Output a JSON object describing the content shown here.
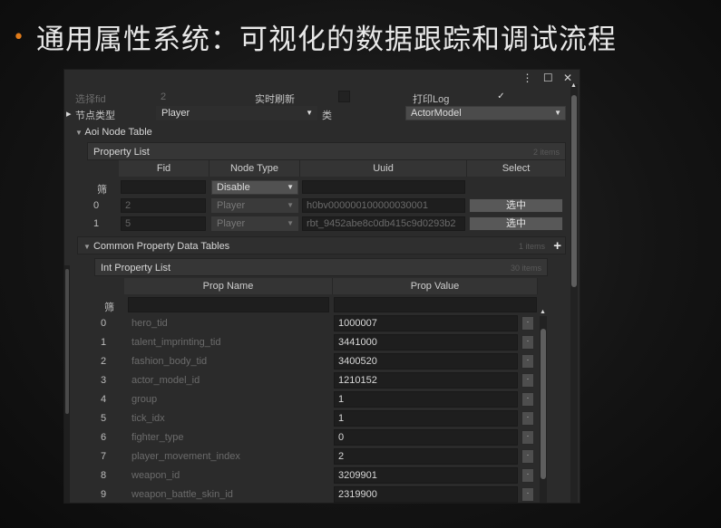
{
  "slide": {
    "bullet": "•",
    "title": "通用属性系统：可视化的数据跟踪和调试流程"
  },
  "window": {
    "controls": "⋮ ☐ ✕"
  },
  "filter_row": {
    "select_fid_label": "选择fid",
    "select_fid_value": "2",
    "refresh_label": "实时刷新",
    "refresh_checked": false,
    "log_label": "打印Log",
    "log_checked": true,
    "log_check_mark": "✓"
  },
  "node_type_row": {
    "label": "节点类型",
    "value": "Player",
    "class_label": "类",
    "class_value": "ActorModel"
  },
  "aoi_table": {
    "title": "Aoi Node Table",
    "list_title": "Property List",
    "count": "2 items",
    "columns": [
      "Fid",
      "Node Type",
      "Uuid",
      "Select"
    ],
    "filter_label": "筛",
    "filter_dropdown": "Disable",
    "rows": [
      {
        "index": "0",
        "fid": "2",
        "node_type": "Player",
        "uuid": "h0bv000000100000030001",
        "select": "选中"
      },
      {
        "index": "1",
        "fid": "5",
        "node_type": "Player",
        "uuid": "rbt_9452abe8c0db415c9d0293b2",
        "select": "选中"
      }
    ]
  },
  "common_tables": {
    "title": "Common Property Data Tables",
    "count": "1 items",
    "add_icon": "+",
    "int_list": {
      "title": "Int Property List",
      "count": "30 items",
      "columns": [
        "Prop Name",
        "Prop Value"
      ],
      "filter_label": "筛",
      "rows": [
        {
          "index": "0",
          "name": "hero_tid",
          "value": "1000007"
        },
        {
          "index": "1",
          "name": "talent_imprinting_tid",
          "value": "3441000"
        },
        {
          "index": "2",
          "name": "fashion_body_tid",
          "value": "3400520"
        },
        {
          "index": "3",
          "name": "actor_model_id",
          "value": "1210152"
        },
        {
          "index": "4",
          "name": "group",
          "value": "1"
        },
        {
          "index": "5",
          "name": "tick_idx",
          "value": "1"
        },
        {
          "index": "6",
          "name": "fighter_type",
          "value": "0"
        },
        {
          "index": "7",
          "name": "player_movement_index",
          "value": "2"
        },
        {
          "index": "8",
          "name": "weapon_id",
          "value": "3209901"
        },
        {
          "index": "9",
          "name": "weapon_battle_skin_id",
          "value": "2319900"
        }
      ]
    }
  },
  "colors": {
    "bullet": "#e07b1a",
    "panel_bg": "#2b2b2b",
    "field_bg": "#1e1e1e"
  }
}
